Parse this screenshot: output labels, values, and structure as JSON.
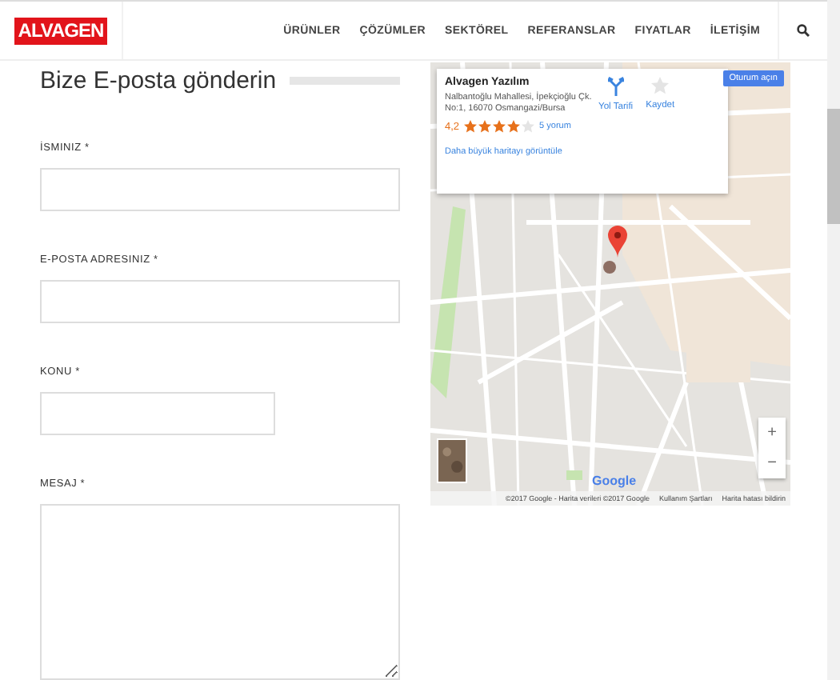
{
  "header": {
    "logo": "ALVAGEN",
    "nav": [
      {
        "label": "ÜRÜNLER"
      },
      {
        "label": "ÇÖZÜMLER"
      },
      {
        "label": "SEKTÖREL"
      },
      {
        "label": "REFERANSLAR"
      },
      {
        "label": "FIYATLAR"
      },
      {
        "label": "İLETİŞİM"
      }
    ]
  },
  "form": {
    "title": "Bize E-posta gönderin",
    "fields": [
      {
        "label": "İSMINIZ *",
        "kind": "text"
      },
      {
        "label": "E-POSTA ADRESINIZ *",
        "kind": "text"
      },
      {
        "label": "KONU *",
        "kind": "short"
      },
      {
        "label": "MESAJ *",
        "kind": "textarea"
      }
    ]
  },
  "map": {
    "sign_in": "Oturum açın",
    "place": {
      "name": "Alvagen Yazılım",
      "address": "Nalbantoğlu Mahallesi, İpekçioğlu Çk. No:1, 16070 Osmangazi/Bursa",
      "rating": "4,2",
      "stars": 4,
      "reviews": "5 yorum",
      "larger_map": "Daha büyük haritayı görüntüle"
    },
    "actions": [
      {
        "label": "Yol Tarifi",
        "kind": "directions"
      },
      {
        "label": "Kaydet",
        "kind": "save"
      }
    ],
    "zoom": [
      "+",
      "−"
    ],
    "logo": "Google",
    "footer": [
      "©2017 Google - Harita verileri ©2017 Google",
      "Kullanım Şartları",
      "Harita hatası bildirin"
    ]
  }
}
